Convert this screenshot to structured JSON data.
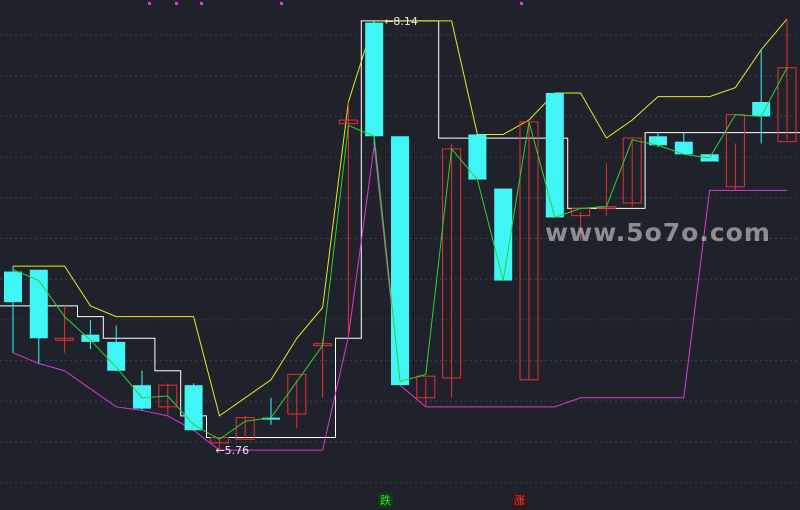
{
  "chart_data": {
    "type": "candlestick",
    "ylim": [
      5.55,
      8.2
    ],
    "grid": true,
    "colors": {
      "background": "#1f222b",
      "up": "#e83030",
      "down": "#3ff5f5",
      "upper_band": "#e8e820",
      "lower_band": "#d63ad6",
      "mid_line": "#30d030",
      "envelope": "#ffffff",
      "grid": "#3a3e48"
    },
    "candles": [
      {
        "o": 6.75,
        "h": 6.78,
        "l": 6.3,
        "c": 6.58
      },
      {
        "o": 6.76,
        "h": 6.76,
        "l": 6.24,
        "c": 6.38
      },
      {
        "o": 6.38,
        "h": 6.56,
        "l": 6.3,
        "c": 6.38
      },
      {
        "o": 6.4,
        "h": 6.48,
        "l": 6.32,
        "c": 6.36
      },
      {
        "o": 6.36,
        "h": 6.45,
        "l": 6.2,
        "c": 6.2
      },
      {
        "o": 6.12,
        "h": 6.2,
        "l": 5.98,
        "c": 5.99
      },
      {
        "o": 6.0,
        "h": 6.13,
        "l": 5.95,
        "c": 6.12
      },
      {
        "o": 6.12,
        "h": 6.13,
        "l": 5.87,
        "c": 5.87
      },
      {
        "o": 5.8,
        "h": 5.83,
        "l": 5.76,
        "c": 5.83
      },
      {
        "o": 5.82,
        "h": 5.95,
        "l": 5.82,
        "c": 5.94
      },
      {
        "o": 5.94,
        "h": 6.05,
        "l": 5.9,
        "c": 5.93
      },
      {
        "o": 5.96,
        "h": 6.15,
        "l": 5.88,
        "c": 6.18
      },
      {
        "o": 6.35,
        "h": 6.38,
        "l": 6.05,
        "c": 6.35
      },
      {
        "o": 7.57,
        "h": 7.69,
        "l": 6.39,
        "c": 7.59
      },
      {
        "o": 8.13,
        "h": 8.14,
        "l": 7.45,
        "c": 7.5
      },
      {
        "o": 7.5,
        "h": 7.5,
        "l": 6.12,
        "c": 6.12
      },
      {
        "o": 6.05,
        "h": 6.16,
        "l": 6.0,
        "c": 6.17
      },
      {
        "o": 6.16,
        "h": 7.46,
        "l": 6.05,
        "c": 7.43
      },
      {
        "o": 7.51,
        "h": 7.51,
        "l": 7.26,
        "c": 7.26
      },
      {
        "o": 7.21,
        "h": 7.21,
        "l": 6.7,
        "c": 6.7
      },
      {
        "o": 6.15,
        "h": 7.59,
        "l": 6.15,
        "c": 7.58
      },
      {
        "o": 7.74,
        "h": 7.74,
        "l": 7.05,
        "c": 7.05
      },
      {
        "o": 7.06,
        "h": 7.08,
        "l": 6.92,
        "c": 7.1
      },
      {
        "o": 7.1,
        "h": 7.35,
        "l": 7.06,
        "c": 7.11
      },
      {
        "o": 7.13,
        "h": 7.49,
        "l": 7.11,
        "c": 7.49
      },
      {
        "o": 7.5,
        "h": 7.52,
        "l": 7.44,
        "c": 7.45
      },
      {
        "o": 7.47,
        "h": 7.52,
        "l": 7.4,
        "c": 7.4
      },
      {
        "o": 7.4,
        "h": 7.4,
        "l": 7.37,
        "c": 7.36
      },
      {
        "o": 7.22,
        "h": 7.46,
        "l": 7.2,
        "c": 7.62
      },
      {
        "o": 7.69,
        "h": 7.98,
        "l": 7.46,
        "c": 7.61
      },
      {
        "o": 7.47,
        "h": 8.15,
        "l": 7.48,
        "c": 7.88
      }
    ],
    "upper_band": [
      6.78,
      6.78,
      6.78,
      6.56,
      6.5,
      6.5,
      6.5,
      6.5,
      5.95,
      6.05,
      6.15,
      6.38,
      6.55,
      7.69,
      8.14,
      8.14,
      8.14,
      8.14,
      7.51,
      7.51,
      7.59,
      7.74,
      7.74,
      7.49,
      7.59,
      7.72,
      7.72,
      7.72,
      7.77,
      7.98,
      8.15
    ],
    "lower_band": [
      6.3,
      6.24,
      6.2,
      6.1,
      6.0,
      5.98,
      5.95,
      5.87,
      5.76,
      5.76,
      5.76,
      5.76,
      5.76,
      6.39,
      7.45,
      6.12,
      6.0,
      6.0,
      6.0,
      6.0,
      6.0,
      6.0,
      6.05,
      6.05,
      6.05,
      6.05,
      6.05,
      7.2,
      7.2,
      7.2,
      7.2
    ],
    "mid_line": [
      6.76,
      6.7,
      6.5,
      6.37,
      6.22,
      6.05,
      6.06,
      5.9,
      5.82,
      5.92,
      5.94,
      6.14,
      6.34,
      7.56,
      7.5,
      6.14,
      6.18,
      7.43,
      7.26,
      6.7,
      7.58,
      7.05,
      7.1,
      7.11,
      7.48,
      7.45,
      7.4,
      7.38,
      7.62,
      7.61,
      7.88
    ],
    "envelope_high": [
      6.56,
      6.56,
      6.56,
      6.5,
      6.38,
      6.38,
      6.2,
      5.95,
      5.83,
      5.83,
      5.83,
      5.83,
      5.83,
      6.38,
      8.14,
      8.14,
      8.14,
      7.49,
      7.49,
      7.49,
      7.49,
      7.49,
      7.1,
      7.1,
      7.1,
      7.52,
      7.52,
      7.52,
      7.52,
      7.52,
      7.52
    ],
    "annotations": [
      {
        "text": "8.14",
        "index": 14,
        "value": 8.14,
        "arrow": "left"
      },
      {
        "text": "5.76",
        "index": 8,
        "value": 5.76,
        "arrow": "left"
      }
    ]
  },
  "labels": {
    "high_label": "8.14",
    "low_label": "5.76",
    "down_marker": "跌",
    "up_marker": "涨",
    "watermark": "www.5o7o.com"
  }
}
